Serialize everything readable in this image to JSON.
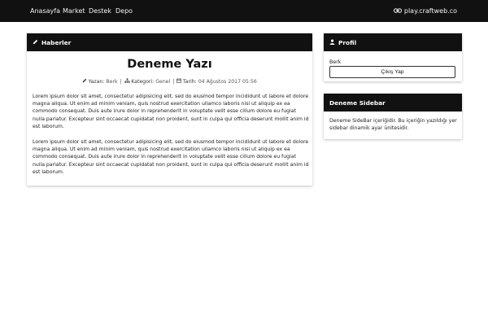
{
  "nav": {
    "links": [
      "Anasayfa",
      "Market",
      "Destek",
      "Depo"
    ],
    "server_address": "play.craftweb.co",
    "server_icon": "link-icon"
  },
  "news_panel": {
    "heading": "Haberler",
    "heading_icon": "pencil-icon",
    "post": {
      "title": "Deneme Yazı",
      "author_label": "Yazan:",
      "author": "Berk",
      "category_label": "Kategori:",
      "category": "Genel",
      "date_label": "Tarih:",
      "date": "04 Ağustos 2017 05:56",
      "paragraphs": [
        "Lorem ipsum dolor sit amet, consectetur adipisicing elit, sed do eiusmod tempor incididunt ut labore et dolore magna aliqua. Ut enim ad minim veniam, quis nostrud exercitation ullamco laboris nisi ut aliquip ex ea commodo consequat. Duis aute irure dolor in reprehenderit in voluptate velit esse cillum dolore eu fugiat nulla pariatur. Excepteur sint occaecat cupidatat non proident, sunt in culpa qui officia deserunt mollit anim id est laborum.",
        "Lorem ipsum dolor sit amet, consectetur adipisicing elit, sed do eiusmod tempor incididunt ut labore et dolore magna aliqua. Ut enim ad minim veniam, quis nostrud exercitation ullamco laboris nisi ut aliquip ex ea commodo consequat. Duis aute irure dolor in reprehenderit in voluptate velit esse cillum dolore eu fugiat nulla pariatur. Excepteur sint occaecat cupidatat non proident, sunt in culpa qui officia deserunt mollit anim id est laborum."
      ]
    }
  },
  "profile_panel": {
    "heading": "Profil",
    "heading_icon": "user-icon",
    "username": "Berk",
    "logout_label": "Çıkış Yap"
  },
  "sidebar_panel": {
    "heading": "Deneme Sidebar",
    "text": "Deneme SideBar içeriğidir. Bu içeriğin yazıldığı yer sidebar dinamik ayar ünitesidir."
  },
  "colors": {
    "navbar_bg": "#111111",
    "panel_header_bg": "#111111",
    "page_bg": "#ffffff"
  }
}
